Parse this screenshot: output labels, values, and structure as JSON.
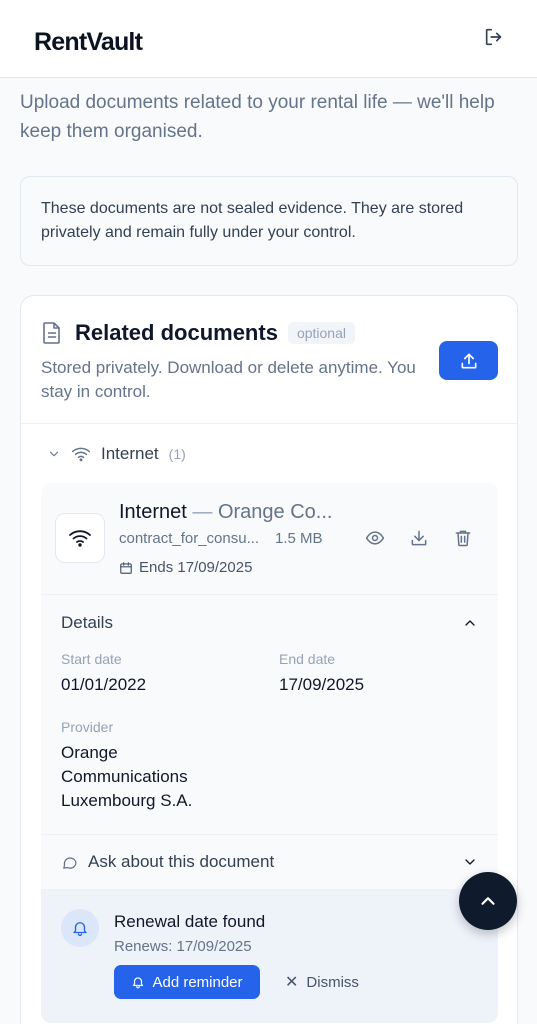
{
  "header": {
    "logo": "RentVault",
    "logout_icon": "logout-icon"
  },
  "intro": "Upload documents related to your rental life — we'll help keep them organised.",
  "notice": "These documents are not sealed evidence. They are stored privately and remain fully under your control.",
  "card": {
    "title": "Related documents",
    "badge": "optional",
    "subtitle": "Stored privately. Download or delete anytime. You stay in control.",
    "upload_icon": "upload-icon"
  },
  "group": {
    "label": "Internet",
    "count": "(1)"
  },
  "document": {
    "category": "Internet",
    "separator": "—",
    "provider_short": "Orange Co...",
    "file_name": "contract_for_consu...",
    "file_size": "1.5 MB",
    "ends": "Ends 17/09/2025"
  },
  "details": {
    "title": "Details",
    "start_label": "Start date",
    "start_value": "01/01/2022",
    "end_label": "End date",
    "end_value": "17/09/2025",
    "provider_label": "Provider",
    "provider_line1": "Orange",
    "provider_line2": "Communications",
    "provider_line3": "Luxembourg S.A."
  },
  "ask": {
    "label": "Ask about this document"
  },
  "reminder": {
    "title": "Renewal date found",
    "subtitle": "Renews: 17/09/2025",
    "add_label": "Add reminder",
    "dismiss_label": "Dismiss"
  },
  "colors": {
    "primary": "#2563eb",
    "fab": "#0f1b2d",
    "text": "#0f172a",
    "muted": "#64748b"
  }
}
